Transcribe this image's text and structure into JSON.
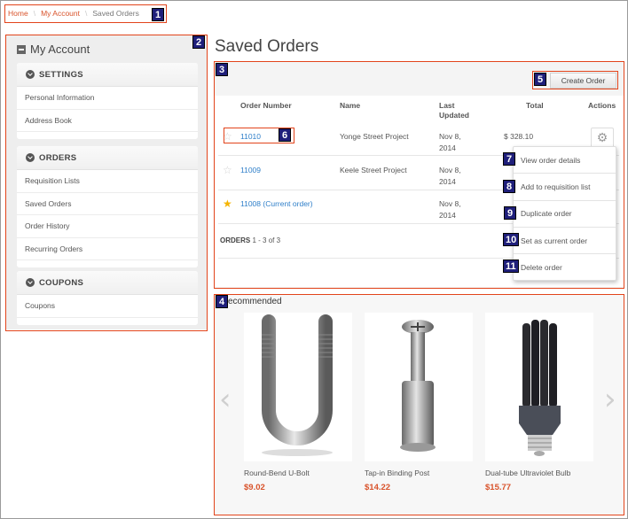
{
  "breadcrumb": {
    "items": [
      "Home",
      "My Account"
    ],
    "current": "Saved Orders",
    "separator": "\\"
  },
  "sidebar": {
    "title": "My Account",
    "groups": [
      {
        "label": "SETTINGS",
        "items": [
          "Personal Information",
          "Address Book"
        ]
      },
      {
        "label": "ORDERS",
        "items": [
          "Requisition Lists",
          "Saved Orders",
          "Order History",
          "Recurring Orders"
        ]
      },
      {
        "label": "COUPONS",
        "items": [
          "Coupons"
        ]
      }
    ]
  },
  "main": {
    "title": "Saved Orders",
    "create_order_label": "Create Order",
    "columns": {
      "order_number": "Order Number",
      "name": "Name",
      "last_updated_1": "Last",
      "last_updated_2": "Updated",
      "total": "Total",
      "actions": "Actions"
    },
    "orders": [
      {
        "number": "11010",
        "name": "Yonge Street Project",
        "date_1": "Nov 8,",
        "date_2": "2014",
        "total": "$ 328.10",
        "favorite": false
      },
      {
        "number": "11009",
        "name": "Keele Street Project",
        "date_1": "Nov 8,",
        "date_2": "2014",
        "total": "",
        "favorite": false
      },
      {
        "number": "11008 (Current order)",
        "name": "",
        "date_1": "Nov 8,",
        "date_2": "2014",
        "total": "",
        "favorite": true
      }
    ],
    "count_label": "ORDERS",
    "count_range": "1 - 3 of 3",
    "actions_menu": [
      "View order details",
      "Add to requisition list",
      "Duplicate order",
      "Set as current order",
      "Delete order"
    ]
  },
  "recommended": {
    "title": "Recommended",
    "visible_title": "ecommended",
    "products": [
      {
        "name": "Round-Bend U-Bolt",
        "price": "$9.02"
      },
      {
        "name": "Tap-in Binding Post",
        "price": "$14.22"
      },
      {
        "name": "Dual-tube Ultraviolet Bulb",
        "price": "$15.77"
      }
    ],
    "prev_icon": "chevron-left-icon",
    "next_icon": "chevron-right-icon"
  },
  "callouts": [
    "1",
    "2",
    "3",
    "4",
    "5",
    "6",
    "7",
    "8",
    "9",
    "10",
    "11"
  ],
  "colors": {
    "accent": "#d9532b",
    "link": "#2f7fc9",
    "highlight": "#e2441b",
    "callout": "#1f1f7a",
    "star": "#f5b400"
  }
}
